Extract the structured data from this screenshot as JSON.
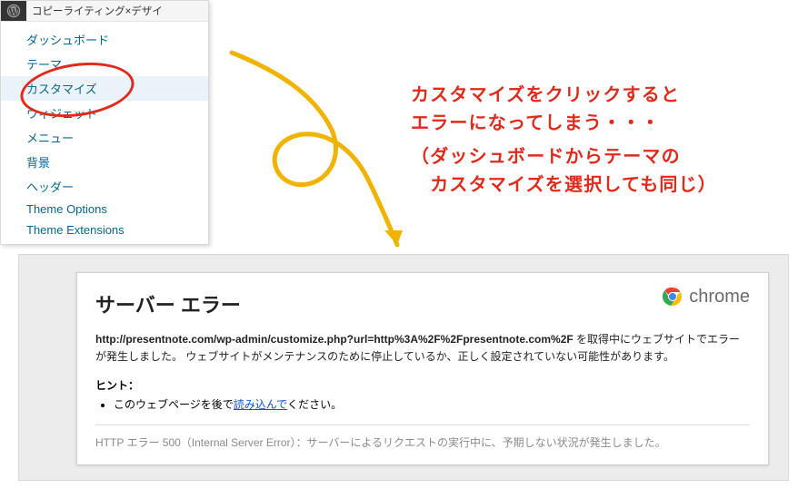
{
  "sidebar": {
    "header": "コピーライティング×デザイ",
    "items": [
      "ダッシュボード",
      "テーマ",
      "カスタマイズ",
      "ウィジェット",
      "メニュー",
      "背景",
      "ヘッダー",
      "Theme Options",
      "Theme Extensions"
    ],
    "selected_index": 2
  },
  "annotation": {
    "line1": "カスタマイズをクリックすると",
    "line2": "エラーになってしまう・・・",
    "line3": "（ダッシュボードからテーマの",
    "line4": "　カスタマイズを選択しても同じ）"
  },
  "error": {
    "title": "サーバー エラー",
    "browser": "chrome",
    "url": "http://presentnote.com/wp-admin/customize.php?url=http%3A%2F%2Fpresentnote.com%2F",
    "body_after_url": " を取得中にウェブサイトでエラーが発生しました。 ウェブサイトがメンテナンスのために停止しているか、正しく設定されていない可能性があります。",
    "hint_label": "ヒント：",
    "hint_item_pre": "このウェブページを後で",
    "hint_item_link": "読み込んで",
    "hint_item_post": "ください。",
    "footer": "HTTP エラー 500（Internal Server Error）：サーバーによるリクエストの実行中に、予期しない状況が発生しました。"
  }
}
